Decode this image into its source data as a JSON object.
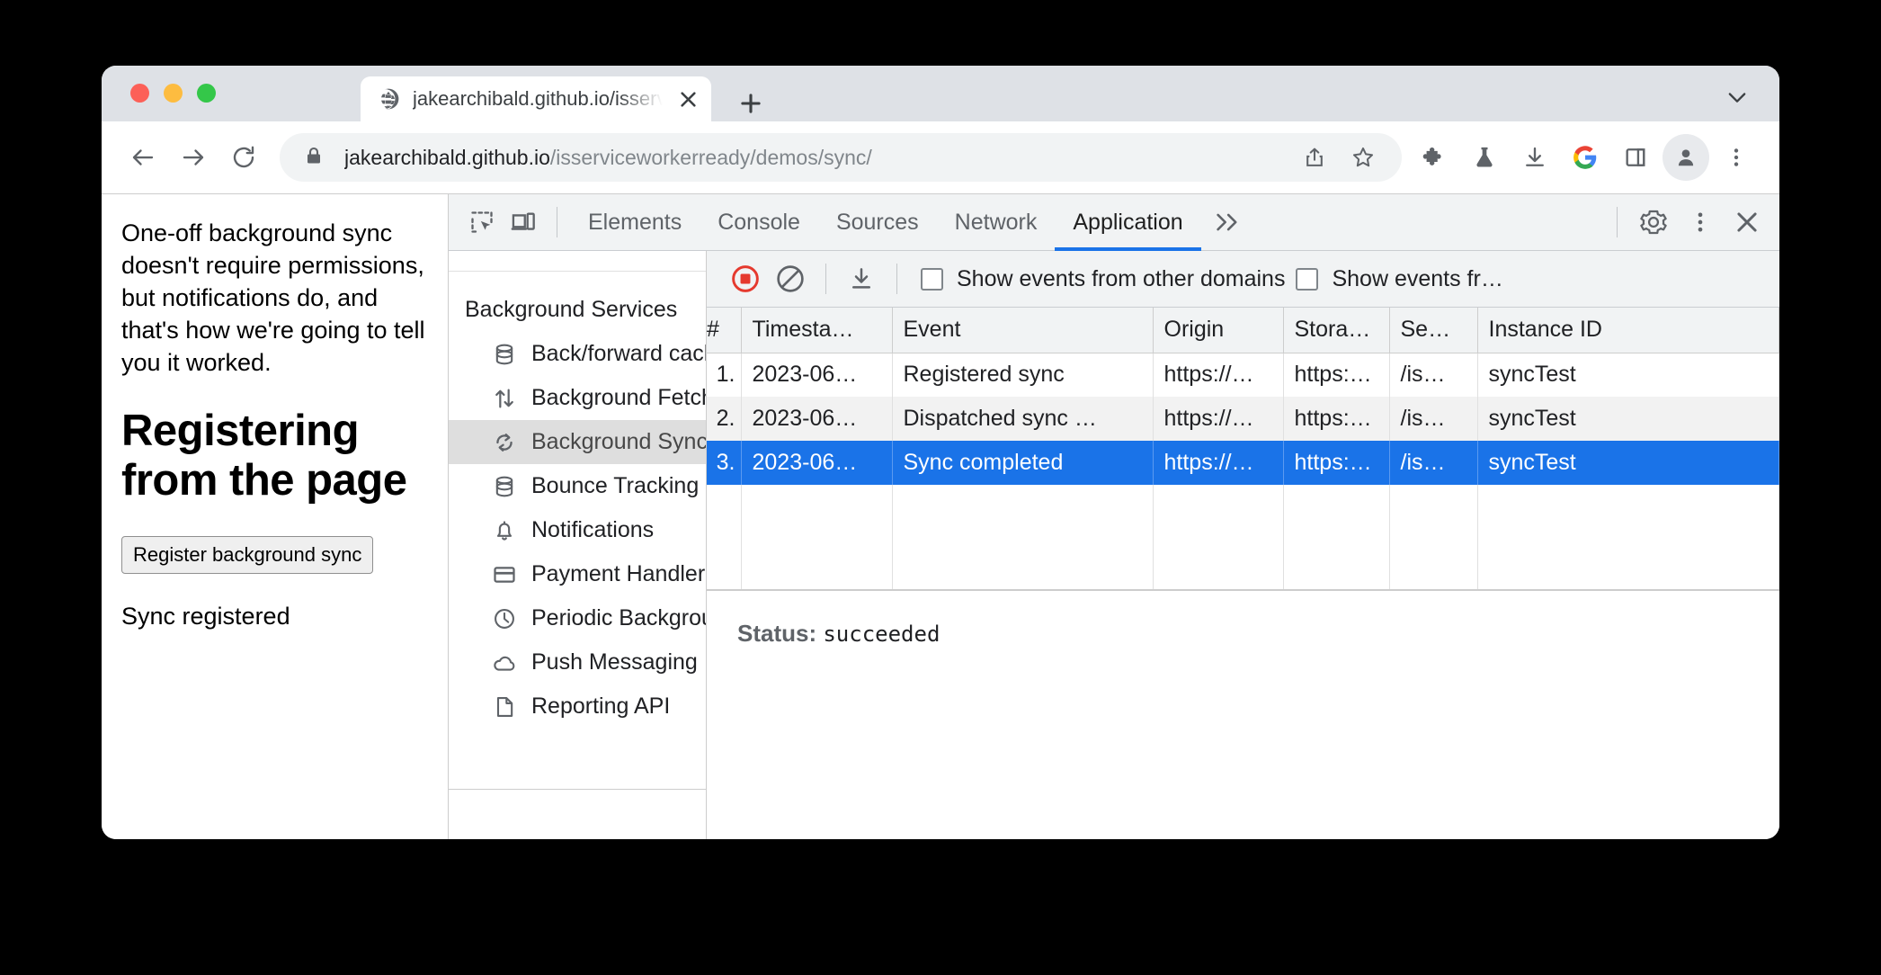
{
  "browser": {
    "tab": {
      "title": "jakearchibald.github.io/isservic",
      "favicon": "globe-icon",
      "close": "×",
      "new_tab": "+"
    },
    "omnibox": {
      "secure_icon": "lock-icon",
      "url_host": "jakearchibald.github.io",
      "url_path": "/isserviceworkerready/demos/sync/"
    },
    "nav": {
      "back": "back-arrow-icon",
      "forward": "forward-arrow-icon",
      "reload": "reload-icon"
    },
    "actions": {
      "share": "share-icon",
      "bookmark": "star-icon",
      "extensions": "puzzle-icon",
      "labs": "flask-icon",
      "downloads": "download-icon",
      "google": "google-icon",
      "side_panel": "side-panel-icon",
      "profile": "person-icon",
      "menu": "kebab-menu-icon",
      "tab_search": "chevron-down-icon"
    }
  },
  "page": {
    "intro": "One-off background sync doesn't require permissions, but notifications do, and that's how we're going to tell you it worked.",
    "heading": "Registering from the page",
    "register_button": "Register background sync",
    "status": "Sync registered"
  },
  "devtools": {
    "toolbar_icons": {
      "inspect": "inspect-element-icon",
      "device": "device-toolbar-icon",
      "settings": "gear-icon",
      "more": "kebab-menu-icon",
      "close": "close-icon",
      "overflow": "double-chevron-right-icon"
    },
    "tabs": [
      {
        "label": "Elements",
        "active": false
      },
      {
        "label": "Console",
        "active": false
      },
      {
        "label": "Sources",
        "active": false
      },
      {
        "label": "Network",
        "active": false
      },
      {
        "label": "Application",
        "active": true
      }
    ],
    "sidebar": {
      "section_title": "Background Services",
      "items": [
        {
          "label": "Back/forward cache",
          "icon": "database-icon",
          "selected": false
        },
        {
          "label": "Background Fetch",
          "icon": "arrows-up-down-icon",
          "selected": false
        },
        {
          "label": "Background Sync",
          "icon": "sync-icon",
          "selected": true
        },
        {
          "label": "Bounce Tracking Mitigations",
          "icon": "database-icon",
          "selected": false
        },
        {
          "label": "Notifications",
          "icon": "bell-icon",
          "selected": false
        },
        {
          "label": "Payment Handler",
          "icon": "credit-card-icon",
          "selected": false
        },
        {
          "label": "Periodic Background Sync",
          "icon": "clock-icon",
          "selected": false
        },
        {
          "label": "Push Messaging",
          "icon": "cloud-icon",
          "selected": false
        },
        {
          "label": "Reporting API",
          "icon": "document-icon",
          "selected": false
        }
      ]
    },
    "background_services": {
      "toolbar": {
        "record": "stop-recording-icon",
        "clear": "clear-icon",
        "export": "download-icon",
        "checkbox_1": "Show events from other domains",
        "checkbox_1_checked": false,
        "checkbox_2": "Show events fr…",
        "checkbox_2_checked": false
      },
      "columns": [
        "#",
        "Timesta…",
        "Event",
        "Origin",
        "Stora…",
        "Se…",
        "Instance ID"
      ],
      "rows": [
        {
          "num": "1.",
          "timestamp": "2023-06…",
          "event": "Registered sync",
          "origin": "https://…",
          "storage": "https:…",
          "sw": "/is…",
          "instance": "syncTest",
          "selected": false
        },
        {
          "num": "2.",
          "timestamp": "2023-06…",
          "event": "Dispatched sync …",
          "origin": "https://…",
          "storage": "https:…",
          "sw": "/is…",
          "instance": "syncTest",
          "selected": false
        },
        {
          "num": "3.",
          "timestamp": "2023-06…",
          "event": "Sync completed",
          "origin": "https://…",
          "storage": "https:…",
          "sw": "/is…",
          "instance": "syncTest",
          "selected": true
        }
      ],
      "detail": {
        "label": "Status:",
        "value": "succeeded"
      }
    }
  },
  "colors": {
    "accent": "#1a73e8",
    "record_red": "#e5392e",
    "tabstrip_bg": "#dee1e6",
    "devtools_bg": "#f1f3f4",
    "selection_blue": "#1a73e8"
  }
}
